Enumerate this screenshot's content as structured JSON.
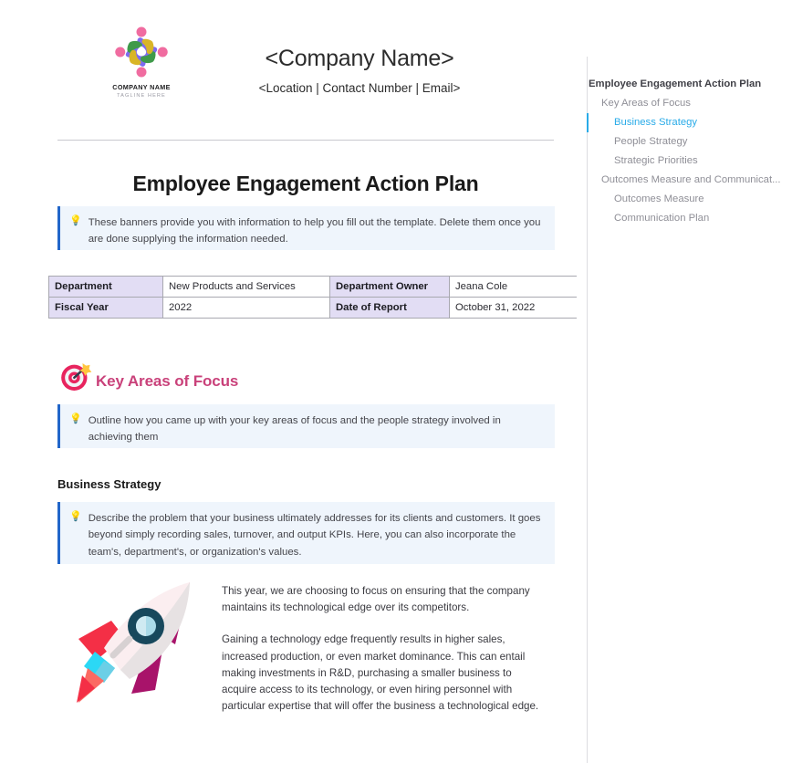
{
  "document": {
    "letterhead": {
      "logo": {
        "icon": "people-pinwheel-logo",
        "name": "COMPANY NAME",
        "tagline": "TAGLINE HERE"
      },
      "company_name": "<Company Name>",
      "company_contact": "<Location | Contact Number | Email>"
    },
    "title": "Employee Engagement Action Plan",
    "banners": {
      "intro": {
        "icon": "lightbulb-icon",
        "glyph": "💡",
        "text": "These banners provide you with information to help you fill out the template. Delete them once you are done supplying the information needed."
      },
      "focus": {
        "icon": "lightbulb-icon",
        "glyph": "💡",
        "text": "Outline how you came up with your key areas of focus and the people strategy involved in achieving them"
      },
      "strategy": {
        "icon": "lightbulb-icon",
        "glyph": "💡",
        "text": "Describe the problem that your business ultimately addresses for its clients and customers. It goes beyond simply recording sales, turnover, and output KPIs. Here, you can also incorporate the team's, department's, or organization's values."
      }
    },
    "meta_table": {
      "rows": [
        {
          "label_left": "Department",
          "value_left": "New Products and Services",
          "label_right": "Department Owner",
          "value_right": "Jeana Cole"
        },
        {
          "label_left": "Fiscal Year",
          "value_left": "2022",
          "label_right": "Date of Report",
          "value_right": "October 31, 2022"
        }
      ]
    },
    "sections": {
      "key_areas": {
        "icon": "target-dart-icon",
        "heading": "Key Areas of Focus"
      },
      "business_strategy": {
        "heading": "Business Strategy",
        "illustration": "rocket-icon",
        "paragraphs": [
          "This year, we are choosing to focus on ensuring that the company maintains its technological edge over its competitors.",
          "Gaining a technology edge frequently results in higher sales, increased production, or even market dominance. This can entail making investments in R&D, purchasing a smaller business to acquire access to its technology, or even hiring personnel with particular expertise that will offer the business a technological edge."
        ]
      }
    }
  },
  "navigation_pane": {
    "items": [
      {
        "label": "Employee Engagement Action Plan",
        "level": 0,
        "active": false
      },
      {
        "label": "Key Areas of Focus",
        "level": 1,
        "active": false
      },
      {
        "label": "Business Strategy",
        "level": 2,
        "active": true
      },
      {
        "label": "People Strategy",
        "level": 2,
        "active": false
      },
      {
        "label": "Strategic Priorities",
        "level": 2,
        "active": false
      },
      {
        "label": "Outcomes Measure and Communicat...",
        "level": 1,
        "active": false
      },
      {
        "label": "Outcomes Measure",
        "level": 2,
        "active": false
      },
      {
        "label": "Communication Plan",
        "level": 2,
        "active": false
      }
    ]
  },
  "colors": {
    "accent_heading": "#c9417a",
    "banner_bg": "#eff5fc",
    "banner_border": "#2266c9",
    "table_header_bg": "#e2ddf4",
    "nav_active": "#29abe8"
  }
}
